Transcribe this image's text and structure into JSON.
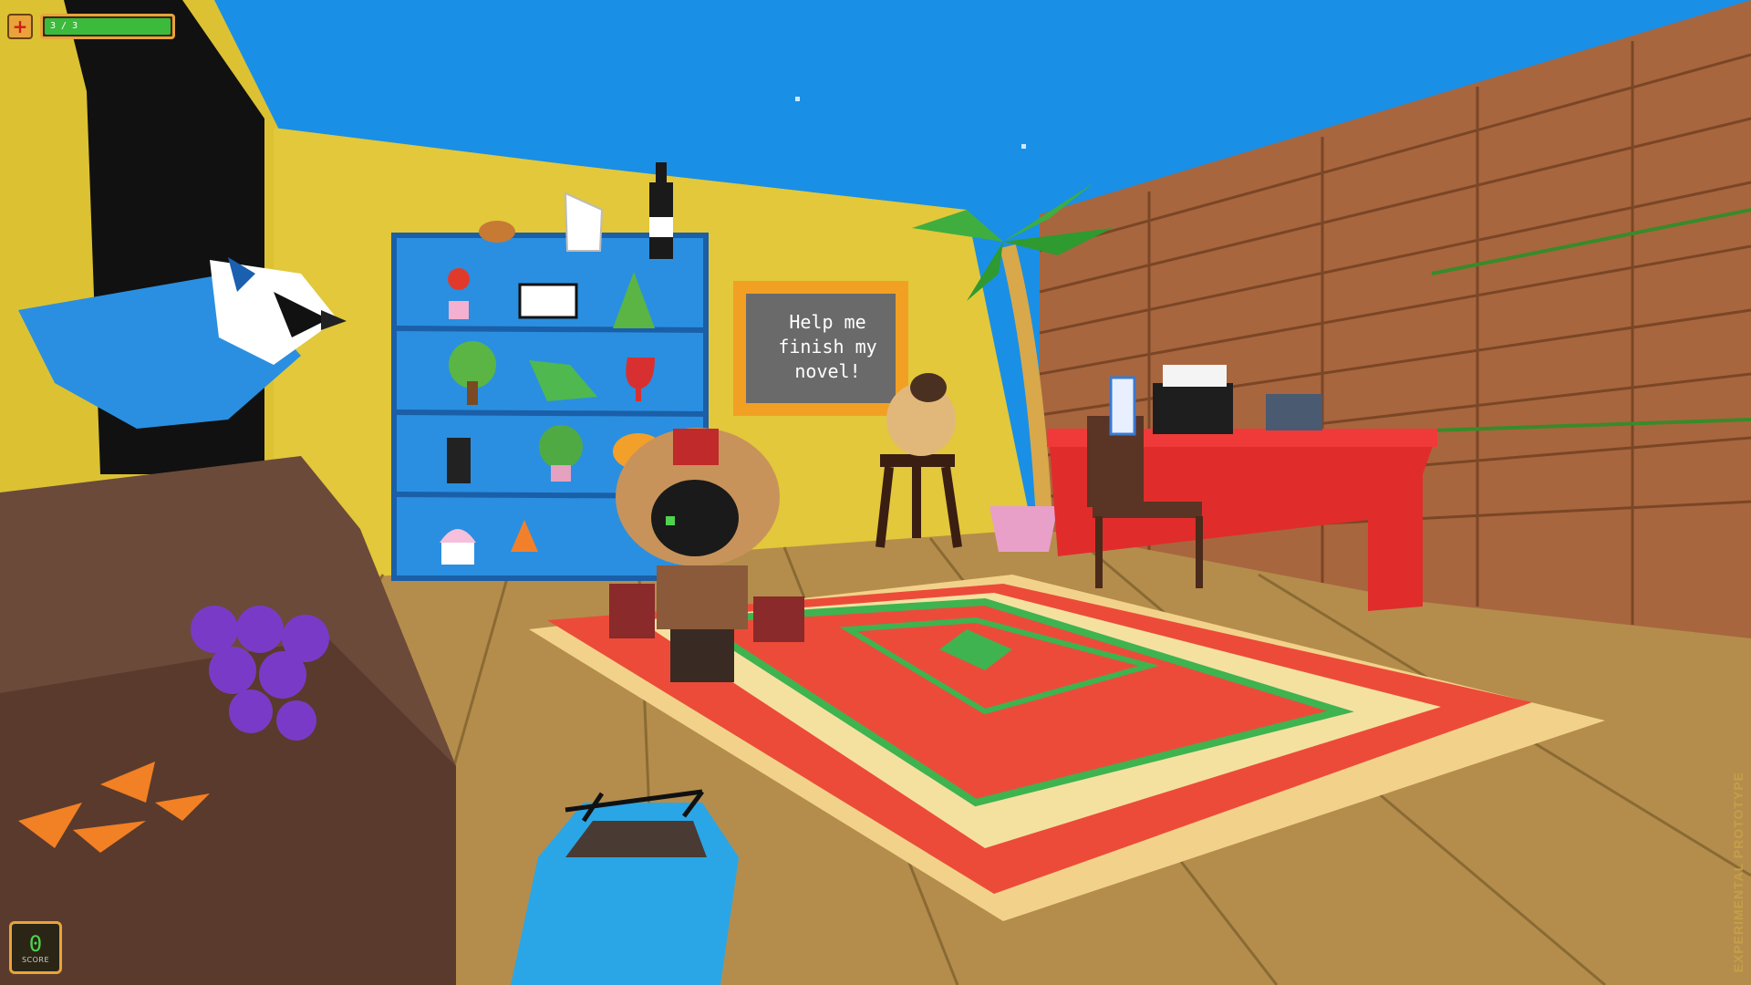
{
  "hud": {
    "health_icon": "health-cross-icon",
    "health_text": "3 / 3",
    "health_fraction": 1.0,
    "health_fill_color": "#3cba3c",
    "score_value": "0",
    "score_label": "SCORE"
  },
  "scene": {
    "sign_text": "Help me\nfinish my\nnovel!",
    "watermark": "EXPERIMENTAL PROTOTYPE"
  },
  "colors": {
    "sky": "#1a8fe6",
    "wall_yellow": "#e0c53a",
    "floor_wood": "#b08a4a",
    "shelf_blue": "#2a8fe0",
    "desk_red": "#e12c2c",
    "hud_accent": "#e8a33a"
  }
}
